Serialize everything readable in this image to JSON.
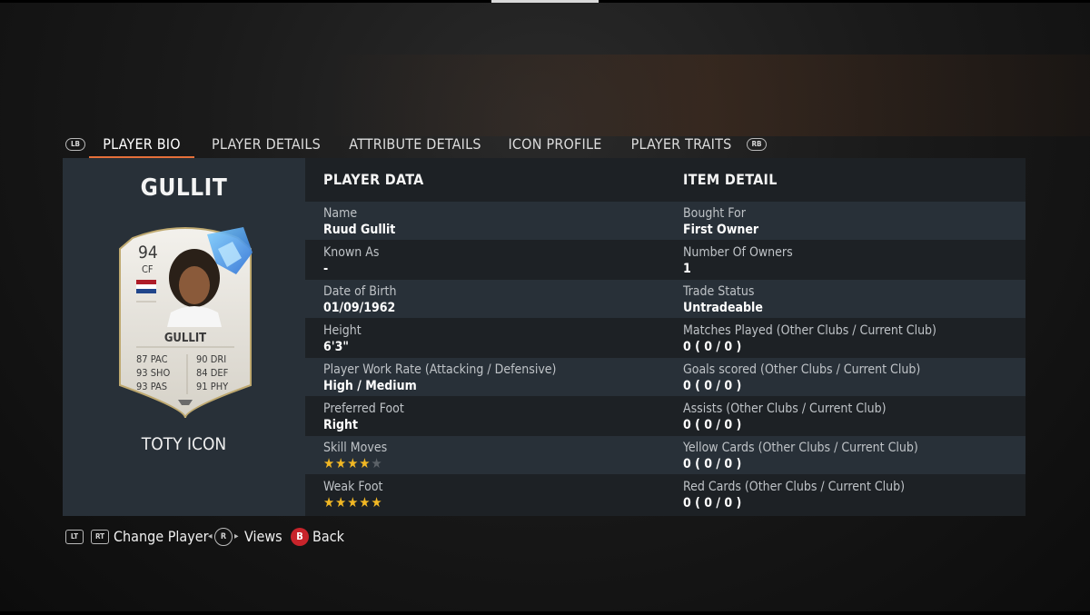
{
  "tabs": {
    "left_bumper": "LB",
    "right_bumper": "RB",
    "items": [
      {
        "label": "PLAYER BIO",
        "active": true
      },
      {
        "label": "PLAYER DETAILS",
        "active": false
      },
      {
        "label": "ATTRIBUTE DETAILS",
        "active": false
      },
      {
        "label": "ICON PROFILE",
        "active": false
      },
      {
        "label": "PLAYER TRAITS",
        "active": false
      }
    ]
  },
  "player": {
    "name": "GULLIT",
    "card_type": "TOTY ICON",
    "card": {
      "rating": "94",
      "position": "CF",
      "name": "GULLIT",
      "nation_flag": "netherlands-flag",
      "stats": [
        "87 PAC",
        "93 SHO",
        "93 PAS",
        "90 DRI",
        "84 DEF",
        "91 PHY"
      ]
    }
  },
  "player_data": {
    "heading": "PLAYER DATA",
    "rows": [
      {
        "label": "Name",
        "value": "Ruud Gullit"
      },
      {
        "label": "Known As",
        "value": "-"
      },
      {
        "label": "Date of Birth",
        "value": "01/09/1962"
      },
      {
        "label": "Height",
        "value": "6'3\""
      },
      {
        "label": "Player Work Rate (Attacking / Defensive)",
        "value": "High / Medium"
      },
      {
        "label": "Preferred Foot",
        "value": "Right"
      },
      {
        "label": "Skill Moves",
        "stars": 4,
        "max_stars": 5
      },
      {
        "label": "Weak Foot",
        "stars": 5,
        "max_stars": 5
      }
    ]
  },
  "item_detail": {
    "heading": "ITEM DETAIL",
    "rows": [
      {
        "label": "Bought For",
        "value": "First Owner"
      },
      {
        "label": "Number Of Owners",
        "value": "1"
      },
      {
        "label": "Trade Status",
        "value": "Untradeable"
      },
      {
        "label": "Matches Played (Other Clubs / Current Club)",
        "value": "0 ( 0 / 0 )"
      },
      {
        "label": "Goals scored (Other Clubs / Current Club)",
        "value": "0 ( 0 / 0 )"
      },
      {
        "label": "Assists (Other Clubs / Current Club)",
        "value": "0 ( 0 / 0 )"
      },
      {
        "label": "Yellow Cards (Other Clubs / Current Club)",
        "value": "0 ( 0 / 0 )"
      },
      {
        "label": "Red Cards (Other Clubs / Current Club)",
        "value": "0 ( 0 / 0 )"
      }
    ]
  },
  "footer": {
    "lt_icon": "LT",
    "rt_icon": "RT",
    "change_player": "Change Player",
    "r_icon": "R",
    "views": "Views",
    "b_icon": "B",
    "back": "Back"
  },
  "colors": {
    "accent": "#e5703a",
    "star_on": "#f2b824",
    "b_button": "#c8242b"
  }
}
